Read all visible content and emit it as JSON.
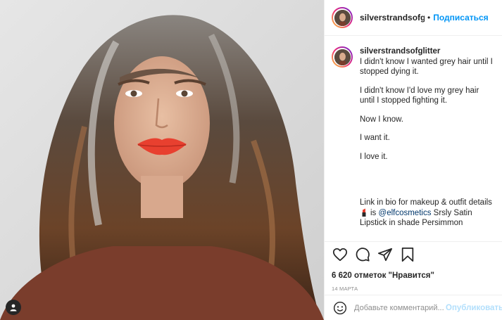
{
  "post": {
    "username": "silverstrandsofglitter",
    "follow_label": "Подписаться",
    "separator": "•",
    "caption_paragraphs": [
      "I didn't know I wanted grey hair until I stopped dying it.",
      "I didn't know I'd love my grey hair until I stopped fighting it.",
      "Now I know.",
      "I want it.",
      "I love it."
    ],
    "caption_link_line": "Link in bio for makeup & outfit details",
    "caption_product_prefix": "is",
    "caption_mention": "@elfcosmetics",
    "caption_product_suffix": "Srsly Satin Lipstick in shade Persimmon",
    "likes": "6 620 отметок \"Нравится\"",
    "date": "14 марта"
  },
  "comment": {
    "placeholder": "Добавьте комментарий...",
    "publish_label": "Опубликовать"
  },
  "icons": [
    "heart-icon",
    "comment-icon",
    "share-icon",
    "save-icon",
    "emoji-icon",
    "user-tag-icon",
    "lipstick-emoji-icon"
  ],
  "colors": {
    "link_blue": "#0095f6",
    "publish_disabled": "#b2dffc",
    "mention": "#00376b",
    "text": "#262626",
    "muted": "#8e8e8e",
    "lip_red": "#e8402f"
  }
}
